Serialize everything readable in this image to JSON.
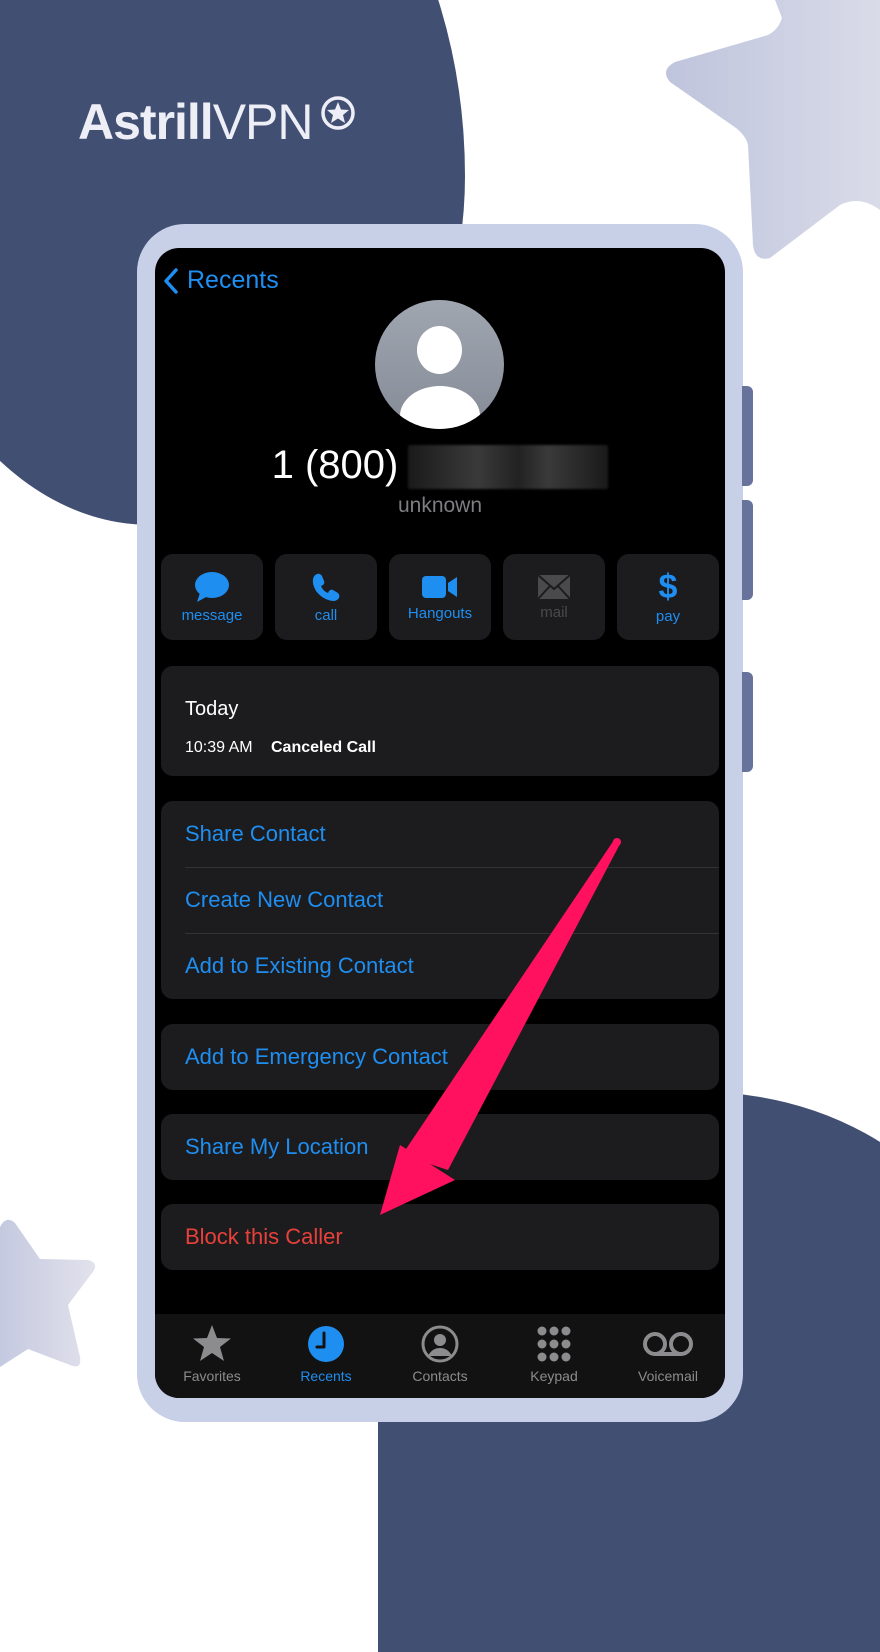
{
  "brand": {
    "name_bold": "Astrill",
    "name_light": "VPN",
    "badge_icon": "star-circle-icon",
    "colors": {
      "navy": "#414f72",
      "frame": "#c8d0e8",
      "star": "#c5c9e0",
      "accent_arrow": "#ff1160"
    }
  },
  "nav": {
    "back_label": "Recents",
    "back_icon": "chevron-left-icon"
  },
  "contact": {
    "avatar_icon": "person-silhouette-icon",
    "number_visible": "1 (800)",
    "number_hidden": "[redacted]",
    "label": "unknown"
  },
  "actions": [
    {
      "label": "message",
      "icon": "message-bubble-icon",
      "enabled": true
    },
    {
      "label": "call",
      "icon": "phone-icon",
      "enabled": true
    },
    {
      "label": "Hangouts",
      "icon": "video-camera-icon",
      "enabled": true
    },
    {
      "label": "mail",
      "icon": "envelope-icon",
      "enabled": false
    },
    {
      "label": "pay",
      "icon": "dollar-icon",
      "enabled": true
    }
  ],
  "history": {
    "day": "Today",
    "time": "10:39 AM",
    "status": "Canceled Call"
  },
  "menu_group_1": [
    {
      "label": "Share Contact"
    },
    {
      "label": "Create New Contact"
    },
    {
      "label": "Add to Existing Contact"
    }
  ],
  "menu_emergency": {
    "label": "Add to Emergency Contact"
  },
  "menu_location": {
    "label": "Share My Location"
  },
  "menu_block": {
    "label": "Block this Caller"
  },
  "tabbar": [
    {
      "label": "Favorites",
      "icon": "star-icon",
      "active": false
    },
    {
      "label": "Recents",
      "icon": "clock-icon",
      "active": true
    },
    {
      "label": "Contacts",
      "icon": "person-circle-icon",
      "active": false
    },
    {
      "label": "Keypad",
      "icon": "keypad-icon",
      "active": false
    },
    {
      "label": "Voicemail",
      "icon": "voicemail-icon",
      "active": false
    }
  ],
  "annotation": {
    "type": "arrow",
    "points_to": "Block this Caller"
  }
}
